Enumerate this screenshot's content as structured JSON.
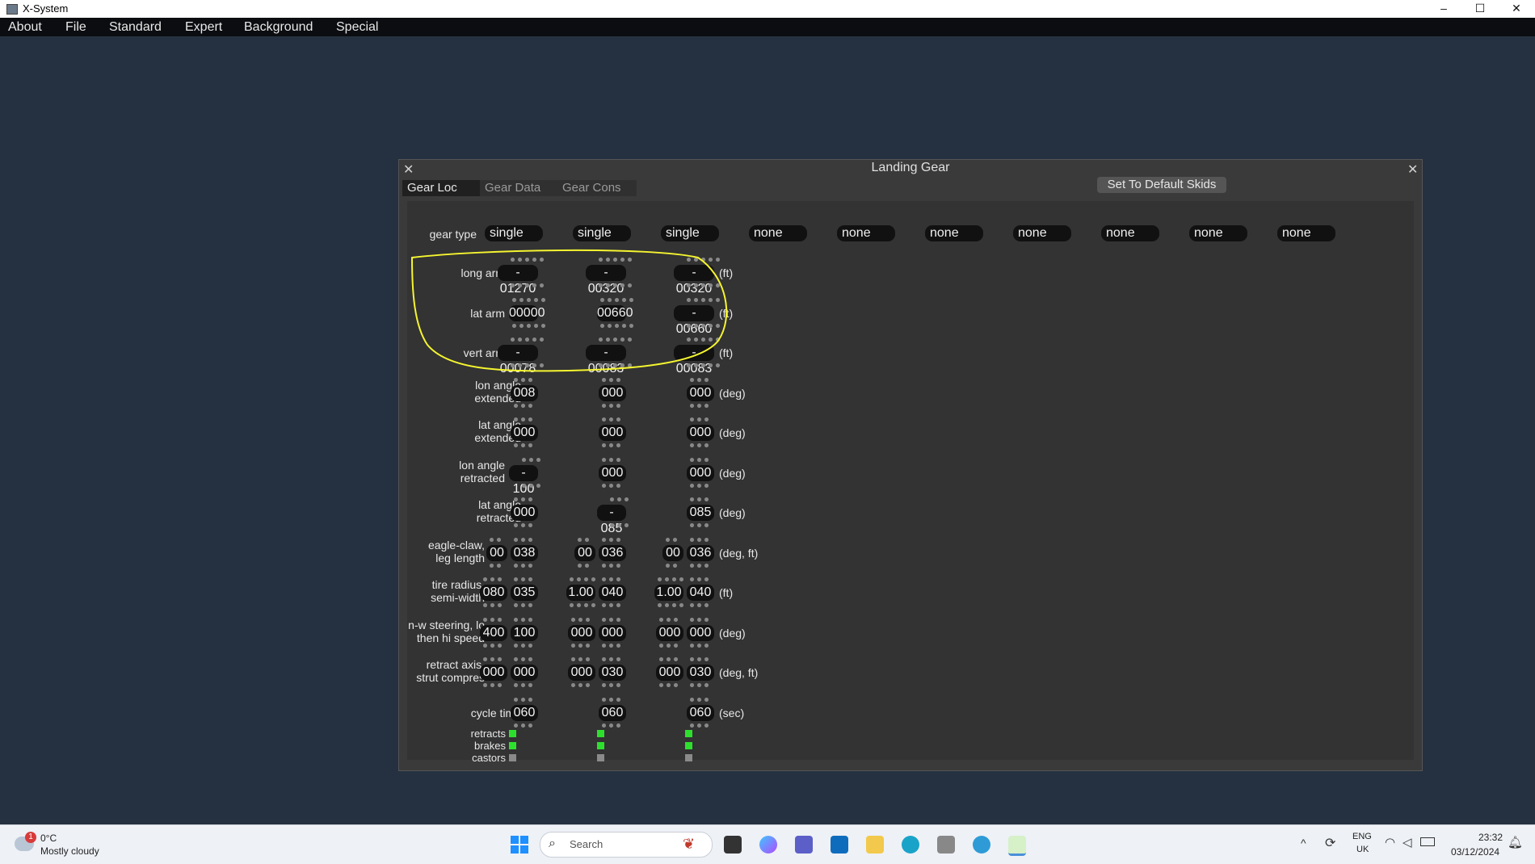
{
  "window": {
    "title": "X-System",
    "minimize_glyph": "–",
    "maximize_glyph": "☐",
    "close_glyph": "✕"
  },
  "menu": [
    "About",
    "File",
    "Standard",
    "Expert",
    "Background",
    "Special"
  ],
  "dialog": {
    "title": "Landing Gear",
    "close_glyph": "✕",
    "tabs": [
      "Gear Loc",
      "Gear Data",
      "Gear Cons"
    ],
    "active_tab": "Gear Loc",
    "default_button": "Set To Default Skids",
    "gear_type_label": "gear type",
    "gear_types": [
      "single",
      "single",
      "single",
      "none",
      "none",
      "none",
      "none",
      "none",
      "none",
      "none"
    ],
    "rows": [
      {
        "label": [
          "long arm"
        ],
        "unit": "(ft)",
        "values": [
          [
            "- 01270"
          ],
          [
            "- 00320"
          ],
          [
            "- 00320"
          ]
        ]
      },
      {
        "label": [
          "lat arm"
        ],
        "unit": "(ft)",
        "values": [
          [
            "00000"
          ],
          [
            "00660"
          ],
          [
            "- 00660"
          ]
        ]
      },
      {
        "label": [
          "vert arm"
        ],
        "unit": "(ft)",
        "values": [
          [
            "- 00078"
          ],
          [
            "- 00083"
          ],
          [
            "- 00083"
          ]
        ]
      },
      {
        "label": [
          "lon angle",
          "extended"
        ],
        "unit": "(deg)",
        "values": [
          [
            "008"
          ],
          [
            "000"
          ],
          [
            "000"
          ]
        ]
      },
      {
        "label": [
          "lat angle",
          "extended"
        ],
        "unit": "(deg)",
        "values": [
          [
            "000"
          ],
          [
            "000"
          ],
          [
            "000"
          ]
        ]
      },
      {
        "label": [
          "lon angle",
          "retracted"
        ],
        "unit": "(deg)",
        "values": [
          [
            "- 100"
          ],
          [
            "000"
          ],
          [
            "000"
          ]
        ]
      },
      {
        "label": [
          "lat angle",
          "retracted"
        ],
        "unit": "(deg)",
        "values": [
          [
            "000"
          ],
          [
            "- 085"
          ],
          [
            "085"
          ]
        ]
      },
      {
        "label": [
          "eagle-claw,",
          "leg length"
        ],
        "unit": "(deg, ft)",
        "values": [
          [
            "00",
            "038"
          ],
          [
            "00",
            "036"
          ],
          [
            "00",
            "036"
          ]
        ]
      },
      {
        "label": [
          "tire radius,",
          "semi-width"
        ],
        "unit": "(ft)",
        "values": [
          [
            "080",
            "035"
          ],
          [
            "1.00",
            "040"
          ],
          [
            "1.00",
            "040"
          ]
        ]
      },
      {
        "label": [
          "n-w steering, lo",
          "then hi speed"
        ],
        "unit": "(deg)",
        "values": [
          [
            "400",
            "100"
          ],
          [
            "000",
            "000"
          ],
          [
            "000",
            "000"
          ]
        ]
      },
      {
        "label": [
          "retract axis,",
          "strut compres"
        ],
        "unit": "(deg, ft)",
        "values": [
          [
            "000",
            "000"
          ],
          [
            "000",
            "030"
          ],
          [
            "000",
            "030"
          ]
        ]
      },
      {
        "label": [
          "cycle time"
        ],
        "unit": "(sec)",
        "values": [
          [
            "060"
          ],
          [
            "060"
          ],
          [
            "060"
          ]
        ]
      }
    ],
    "checks": {
      "labels": [
        "retracts",
        "brakes",
        "castors"
      ],
      "states": [
        [
          "on",
          "on",
          "on"
        ],
        [
          "on",
          "on",
          "on"
        ],
        [
          "off",
          "off",
          "off"
        ]
      ]
    },
    "highlight_color": "#f5f530"
  },
  "taskbar": {
    "weather_temp": "0°C",
    "weather_desc": "Mostly cloudy",
    "weather_badge": "1",
    "search_placeholder": "Search",
    "lang": "ENG",
    "region": "UK",
    "time": "23:32",
    "date": "03/12/2024",
    "tray_chevron": "^"
  }
}
